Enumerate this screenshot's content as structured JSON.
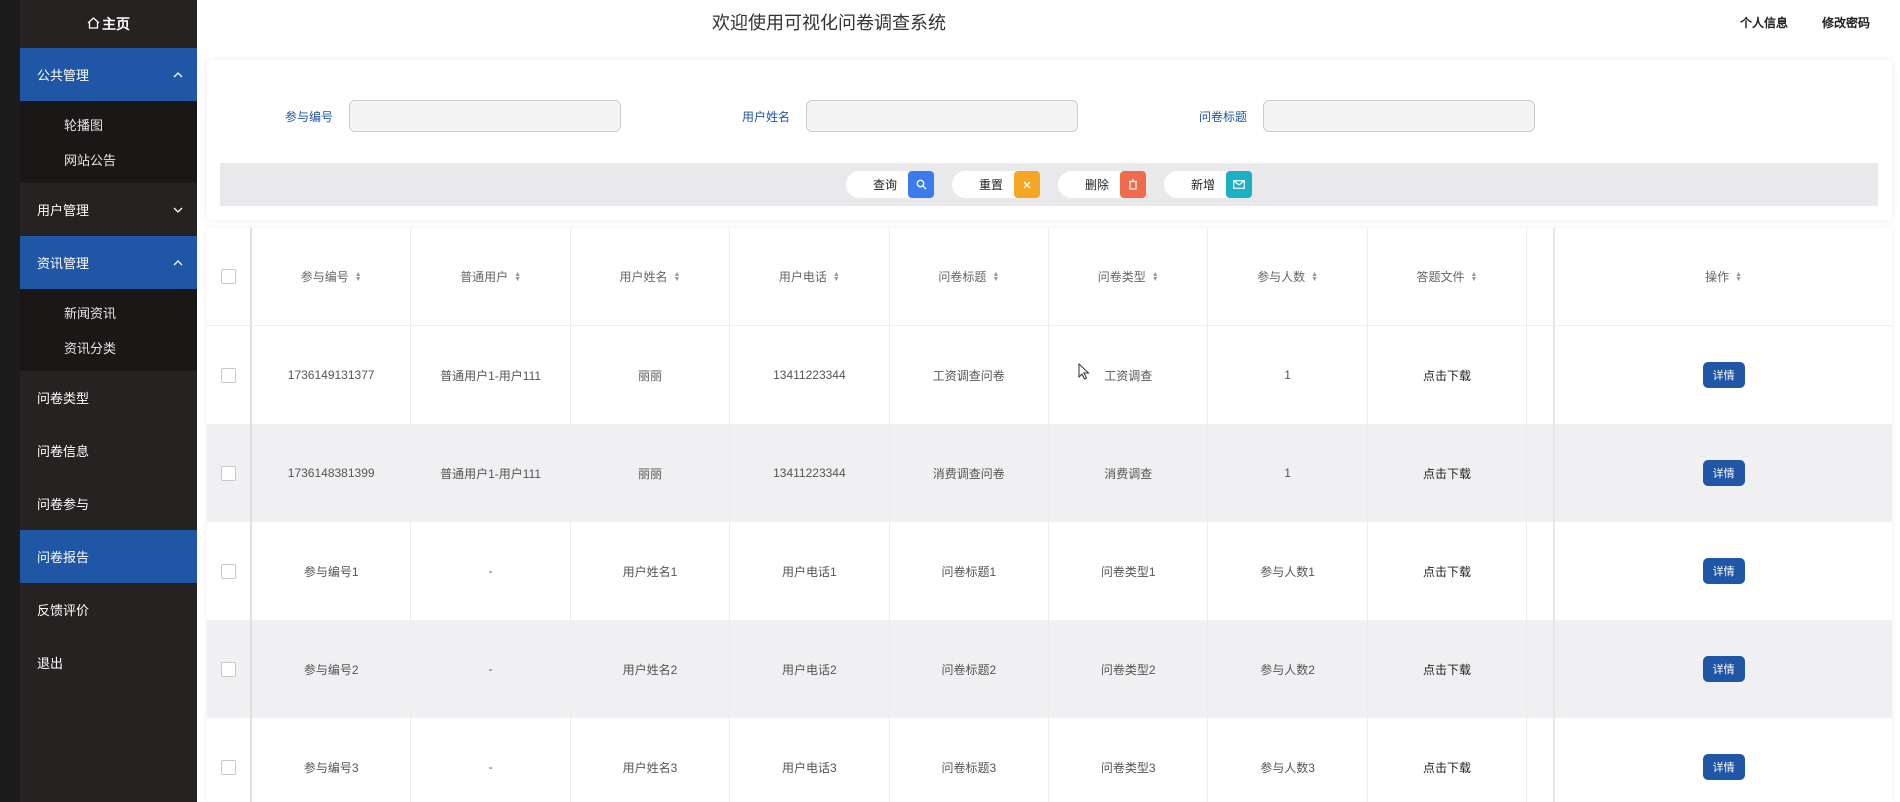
{
  "sidebar": {
    "home": "主页",
    "groups": [
      {
        "label": "公共管理",
        "items": [
          "轮播图",
          "网站公告"
        ]
      },
      {
        "label": "用户管理"
      },
      {
        "label": "资讯管理",
        "items": [
          "新闻资讯",
          "资讯分类"
        ]
      }
    ],
    "items": [
      "问卷类型",
      "问卷信息",
      "问卷参与",
      "问卷报告",
      "反馈评价",
      "退出"
    ]
  },
  "header": {
    "title": "欢迎使用可视化问卷调查系统",
    "profile": "个人信息",
    "password": "修改密码"
  },
  "search": {
    "fields": [
      {
        "label": "参与编号",
        "value": ""
      },
      {
        "label": "用户姓名",
        "value": ""
      },
      {
        "label": "问卷标题",
        "value": ""
      }
    ],
    "buttons": {
      "query": "查询",
      "reset": "重置",
      "delete": "删除",
      "add": "新增"
    }
  },
  "table": {
    "headers": [
      "参与编号",
      "普通用户",
      "用户姓名",
      "用户电话",
      "问卷标题",
      "问卷类型",
      "参与人数",
      "答题文件",
      "操作"
    ],
    "rows": [
      [
        "1736149131377",
        "普通用户1-用户111",
        "丽丽",
        "13411223344",
        "工资调查问卷",
        "工资调查",
        "1",
        "点击下载"
      ],
      [
        "1736148381399",
        "普通用户1-用户111",
        "丽丽",
        "13411223344",
        "消费调查问卷",
        "消费调查",
        "1",
        "点击下载"
      ],
      [
        "参与编号1",
        "-",
        "用户姓名1",
        "用户电话1",
        "问卷标题1",
        "问卷类型1",
        "参与人数1",
        "点击下载"
      ],
      [
        "参与编号2",
        "-",
        "用户姓名2",
        "用户电话2",
        "问卷标题2",
        "问卷类型2",
        "参与人数2",
        "点击下载"
      ],
      [
        "参与编号3",
        "-",
        "用户姓名3",
        "用户电话3",
        "问卷标题3",
        "问卷类型3",
        "参与人数3",
        "点击下载"
      ]
    ],
    "detail_label": "详情"
  },
  "colors": {
    "accent": "#1f56a6",
    "sidebar_bg": "#262221",
    "query": "#3a7bf0",
    "reset": "#f5a623",
    "delete": "#f06a4c",
    "add": "#1bb0c4"
  }
}
